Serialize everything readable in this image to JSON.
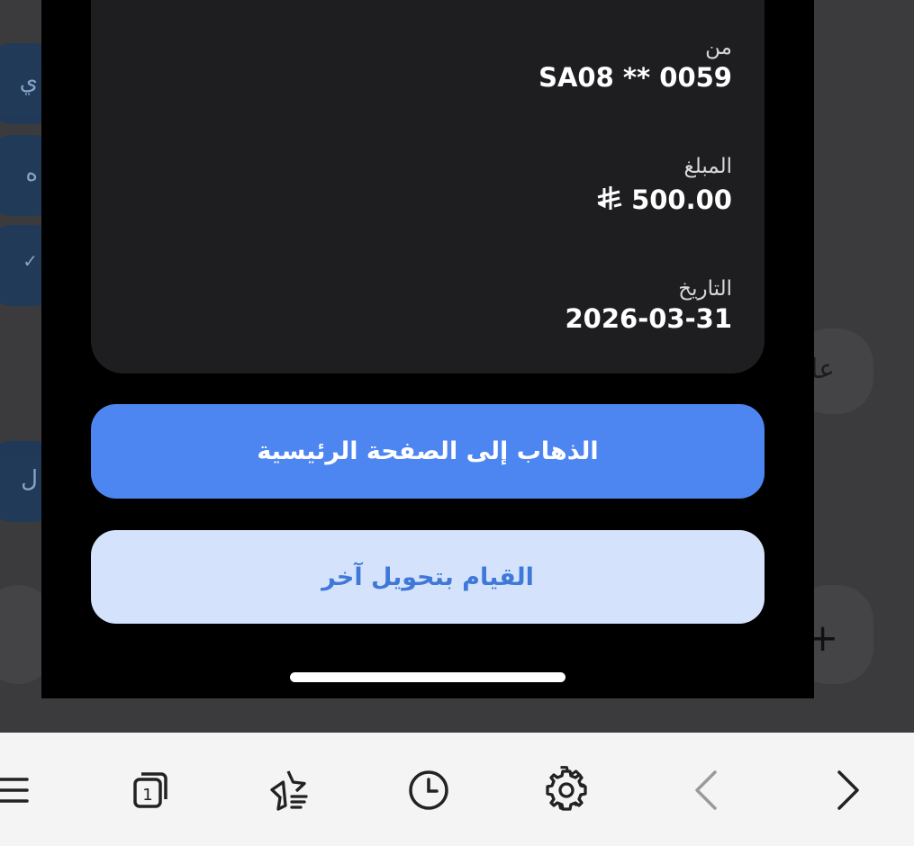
{
  "receipt": {
    "from_label": "من",
    "from_value": "SA08 ** 0059",
    "amount_label": "المبلغ",
    "amount_value": "500.00",
    "amount_currency_icon": "riyal-symbol",
    "date_label": "التاريخ",
    "date_value": "2026-03-31"
  },
  "actions": {
    "go_home_label": "الذهاب إلى الصفحة الرئيسية",
    "new_transfer_label": "القيام بتحويل آخر"
  },
  "background": {
    "partial_texts": [
      "ي",
      "ه",
      "ل",
      "عا"
    ]
  },
  "toolbar": {
    "items": [
      {
        "icon": "menu-icon"
      },
      {
        "icon": "tabs-icon",
        "count": "1"
      },
      {
        "icon": "bookmarks-icon"
      },
      {
        "icon": "history-icon"
      },
      {
        "icon": "settings-icon"
      },
      {
        "icon": "back-icon"
      },
      {
        "icon": "forward-icon"
      }
    ]
  },
  "colors": {
    "primary_button": "#4d86f0",
    "secondary_button": "#d4e3fb",
    "secondary_text": "#3f78d8",
    "card_bg": "#1e1e20"
  }
}
